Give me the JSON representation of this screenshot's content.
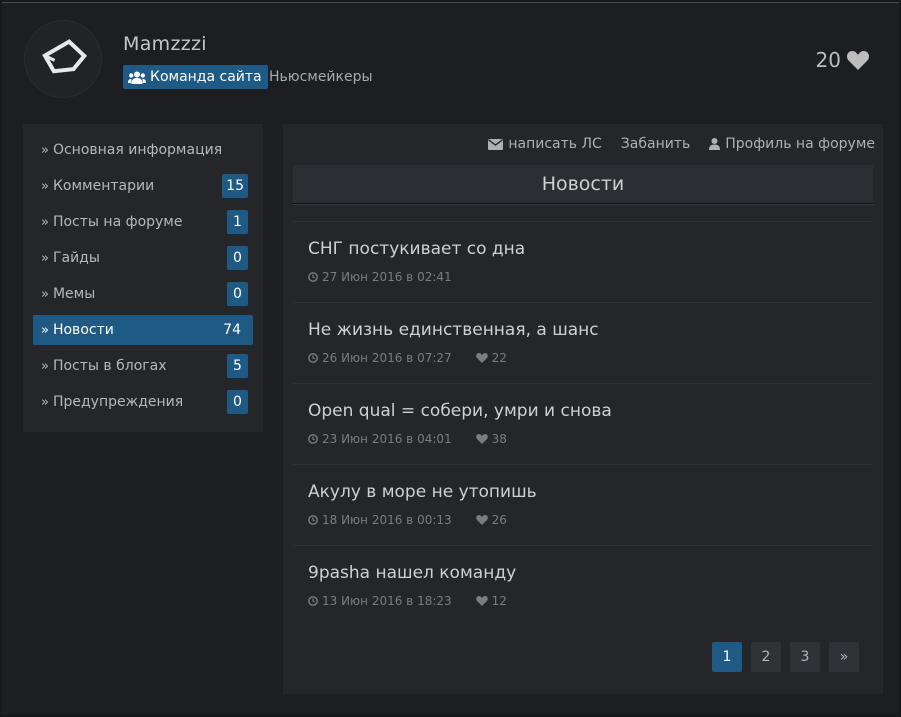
{
  "profile": {
    "username": "Mamzzzi",
    "team_badge": "Команда сайта",
    "group": "Ньюсмейкеры",
    "likes": "20"
  },
  "sidebar": {
    "items": [
      {
        "label": "Основная информация",
        "count": ""
      },
      {
        "label": "Комментарии",
        "count": "15"
      },
      {
        "label": "Посты на форуме",
        "count": "1"
      },
      {
        "label": "Гайды",
        "count": "0"
      },
      {
        "label": "Мемы",
        "count": "0"
      },
      {
        "label": "Новости",
        "count": "74",
        "active": true
      },
      {
        "label": "Посты в блогах",
        "count": "5"
      },
      {
        "label": "Предупреждения",
        "count": "0"
      }
    ]
  },
  "actions": {
    "message": "написать ЛС",
    "ban": "Забанить",
    "forum_profile": "Профиль на форуме"
  },
  "section": {
    "title": "Новости"
  },
  "news": [
    {
      "title": "СНГ постукивает со дна",
      "date": "27 Июн 2016 в 02:41",
      "likes": ""
    },
    {
      "title": "Не жизнь единственная, а шанс",
      "date": "26 Июн 2016 в 07:27",
      "likes": "22"
    },
    {
      "title": "Open qual = собери, умри и снова",
      "date": "23 Июн 2016 в 04:01",
      "likes": "38"
    },
    {
      "title": "Акулу в море не утопишь",
      "date": "18 Июн 2016 в 00:13",
      "likes": "26"
    },
    {
      "title": "9pasha нашел команду",
      "date": "13 Июн 2016 в 18:23",
      "likes": "12"
    }
  ],
  "pagination": {
    "pages": [
      "1",
      "2",
      "3"
    ],
    "current": "1",
    "next": "»"
  },
  "colors": {
    "accent": "#1f5a85",
    "background": "#1d1e22",
    "panel": "#25262a"
  }
}
